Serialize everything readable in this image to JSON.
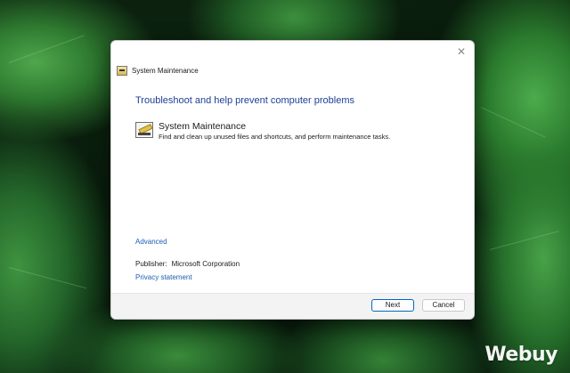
{
  "dialog": {
    "window_title": "System Maintenance",
    "close_glyph": "✕",
    "heading": "Troubleshoot and help prevent computer problems",
    "item": {
      "title": "System Maintenance",
      "description": "Find and clean up unused files and shortcuts, and perform maintenance tasks."
    },
    "advanced_link": "Advanced",
    "publisher_label": "Publisher:",
    "publisher_value": "Microsoft Corporation",
    "privacy_link": "Privacy statement",
    "buttons": {
      "next": "Next",
      "cancel": "Cancel"
    }
  },
  "watermark": "Webuy",
  "colors": {
    "heading": "#1d3f95",
    "link": "#1a5fb4",
    "accent": "#0067c0"
  },
  "icons": {
    "title_icon": "system-maintenance-icon",
    "item_icon": "system-maintenance-icon",
    "close": "close-icon"
  }
}
